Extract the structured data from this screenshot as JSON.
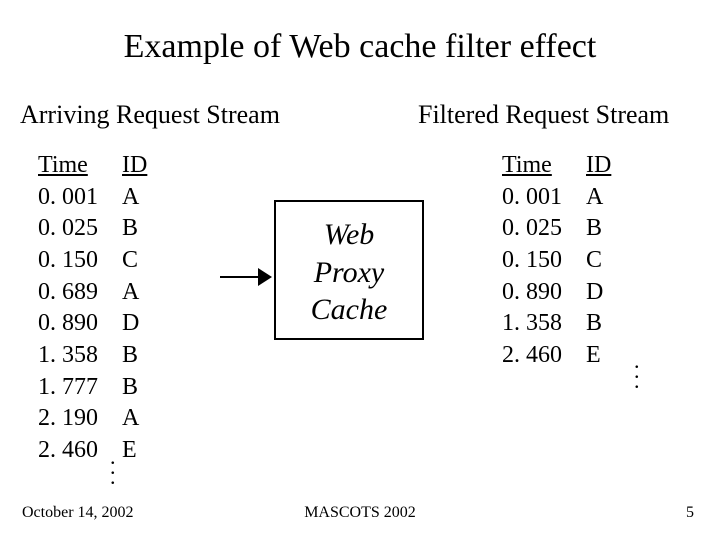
{
  "title": "Example of Web cache filter effect",
  "left": {
    "label": "Arriving Request Stream",
    "time_header": "Time",
    "id_header": "ID",
    "rows": [
      {
        "time": "0. 001",
        "id": "A"
      },
      {
        "time": "0. 025",
        "id": "B"
      },
      {
        "time": "0. 150",
        "id": "C"
      },
      {
        "time": "0. 689",
        "id": "A"
      },
      {
        "time": "0. 890",
        "id": "D"
      },
      {
        "time": "1. 358",
        "id": "B"
      },
      {
        "time": "1. 777",
        "id": "B"
      },
      {
        "time": "2. 190",
        "id": "A"
      },
      {
        "time": "2. 460",
        "id": "E"
      }
    ]
  },
  "right": {
    "label": "Filtered Request Stream",
    "time_header": "Time",
    "id_header": "ID",
    "rows": [
      {
        "time": "0. 001",
        "id": "A"
      },
      {
        "time": "0. 025",
        "id": "B"
      },
      {
        "time": "0. 150",
        "id": "C"
      },
      {
        "time": "0. 890",
        "id": "D"
      },
      {
        "time": "1. 358",
        "id": "B"
      },
      {
        "time": "2. 460",
        "id": "E"
      }
    ]
  },
  "cache": {
    "line1": "Web",
    "line2": "Proxy",
    "line3": "Cache"
  },
  "footer": {
    "date": "October 14, 2002",
    "venue": "MASCOTS 2002",
    "page": "5"
  }
}
